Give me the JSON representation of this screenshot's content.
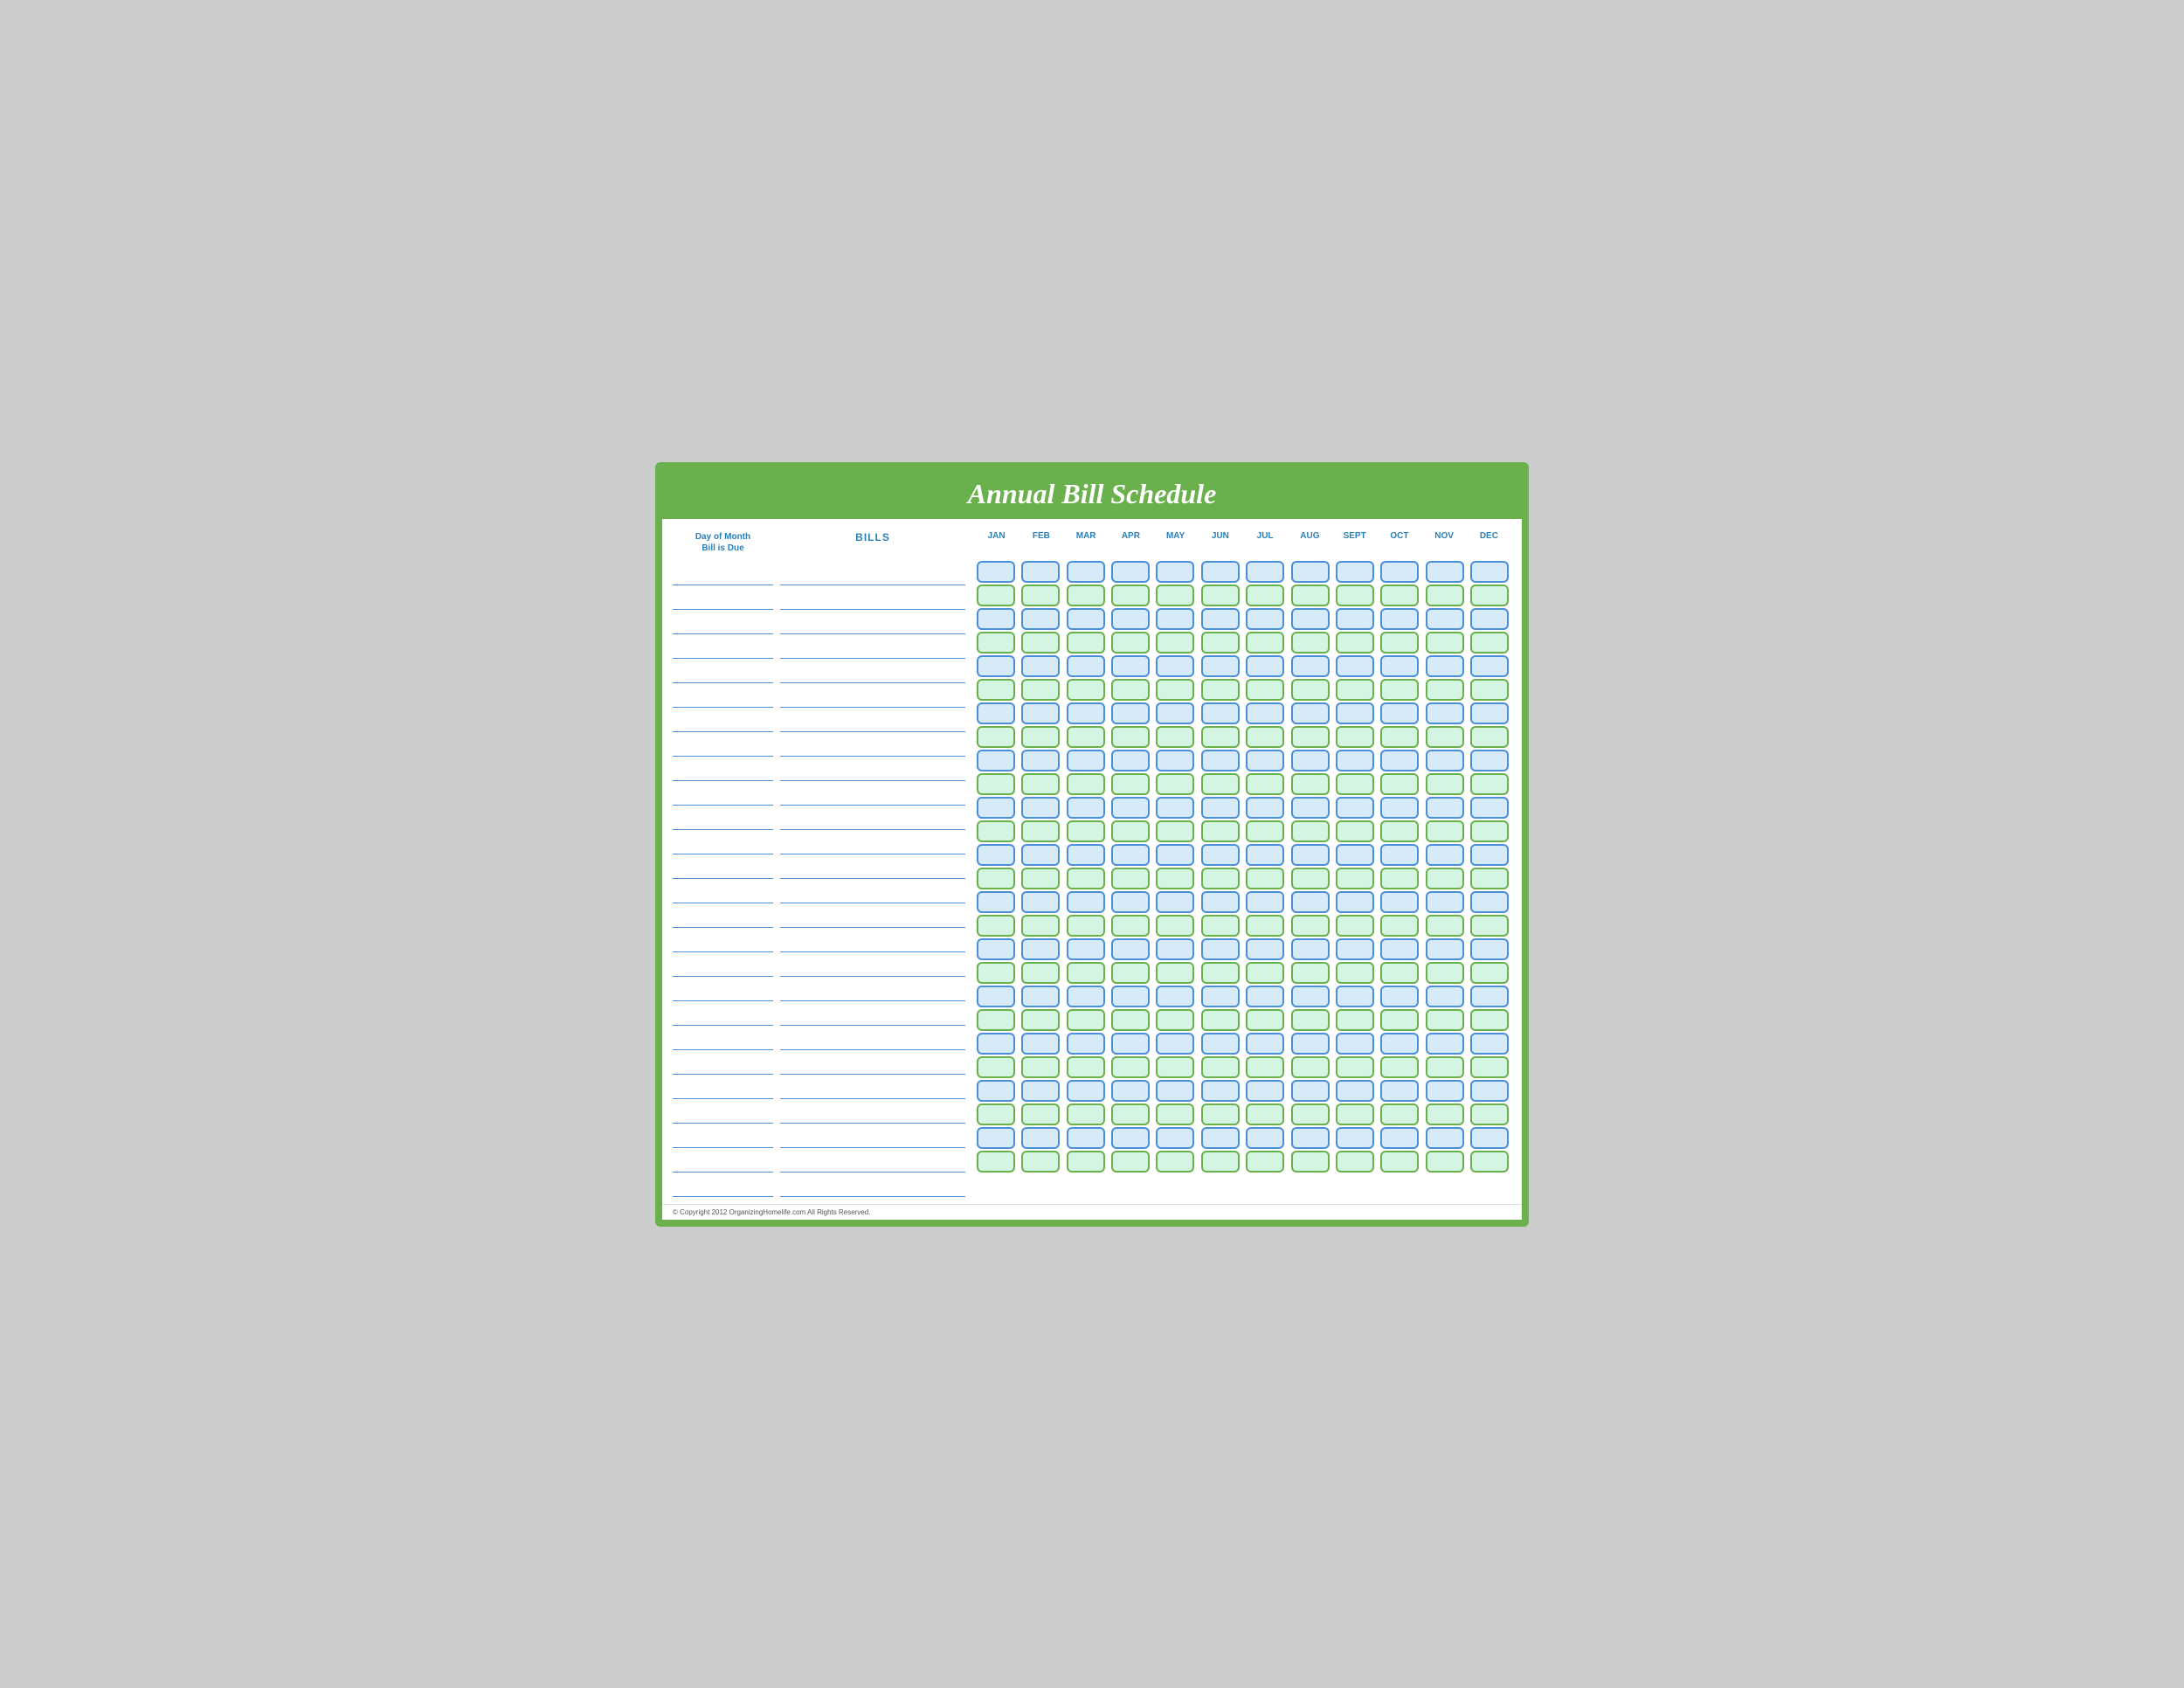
{
  "header": {
    "title": "Annual Bill Schedule"
  },
  "left": {
    "day_col_line1": "Day of Month",
    "day_col_line2": "Bill is Due",
    "bills_header": "BILLS"
  },
  "months": {
    "labels": [
      "JAN",
      "FEB",
      "MAR",
      "APR",
      "MAY",
      "JUN",
      "JUL",
      "AUG",
      "SEPT",
      "OCT",
      "NOV",
      "DEC"
    ]
  },
  "rows": 26,
  "footer": {
    "copyright": "© Copyright 2012 OrganizingHomelife.com All Rights Reserved."
  }
}
